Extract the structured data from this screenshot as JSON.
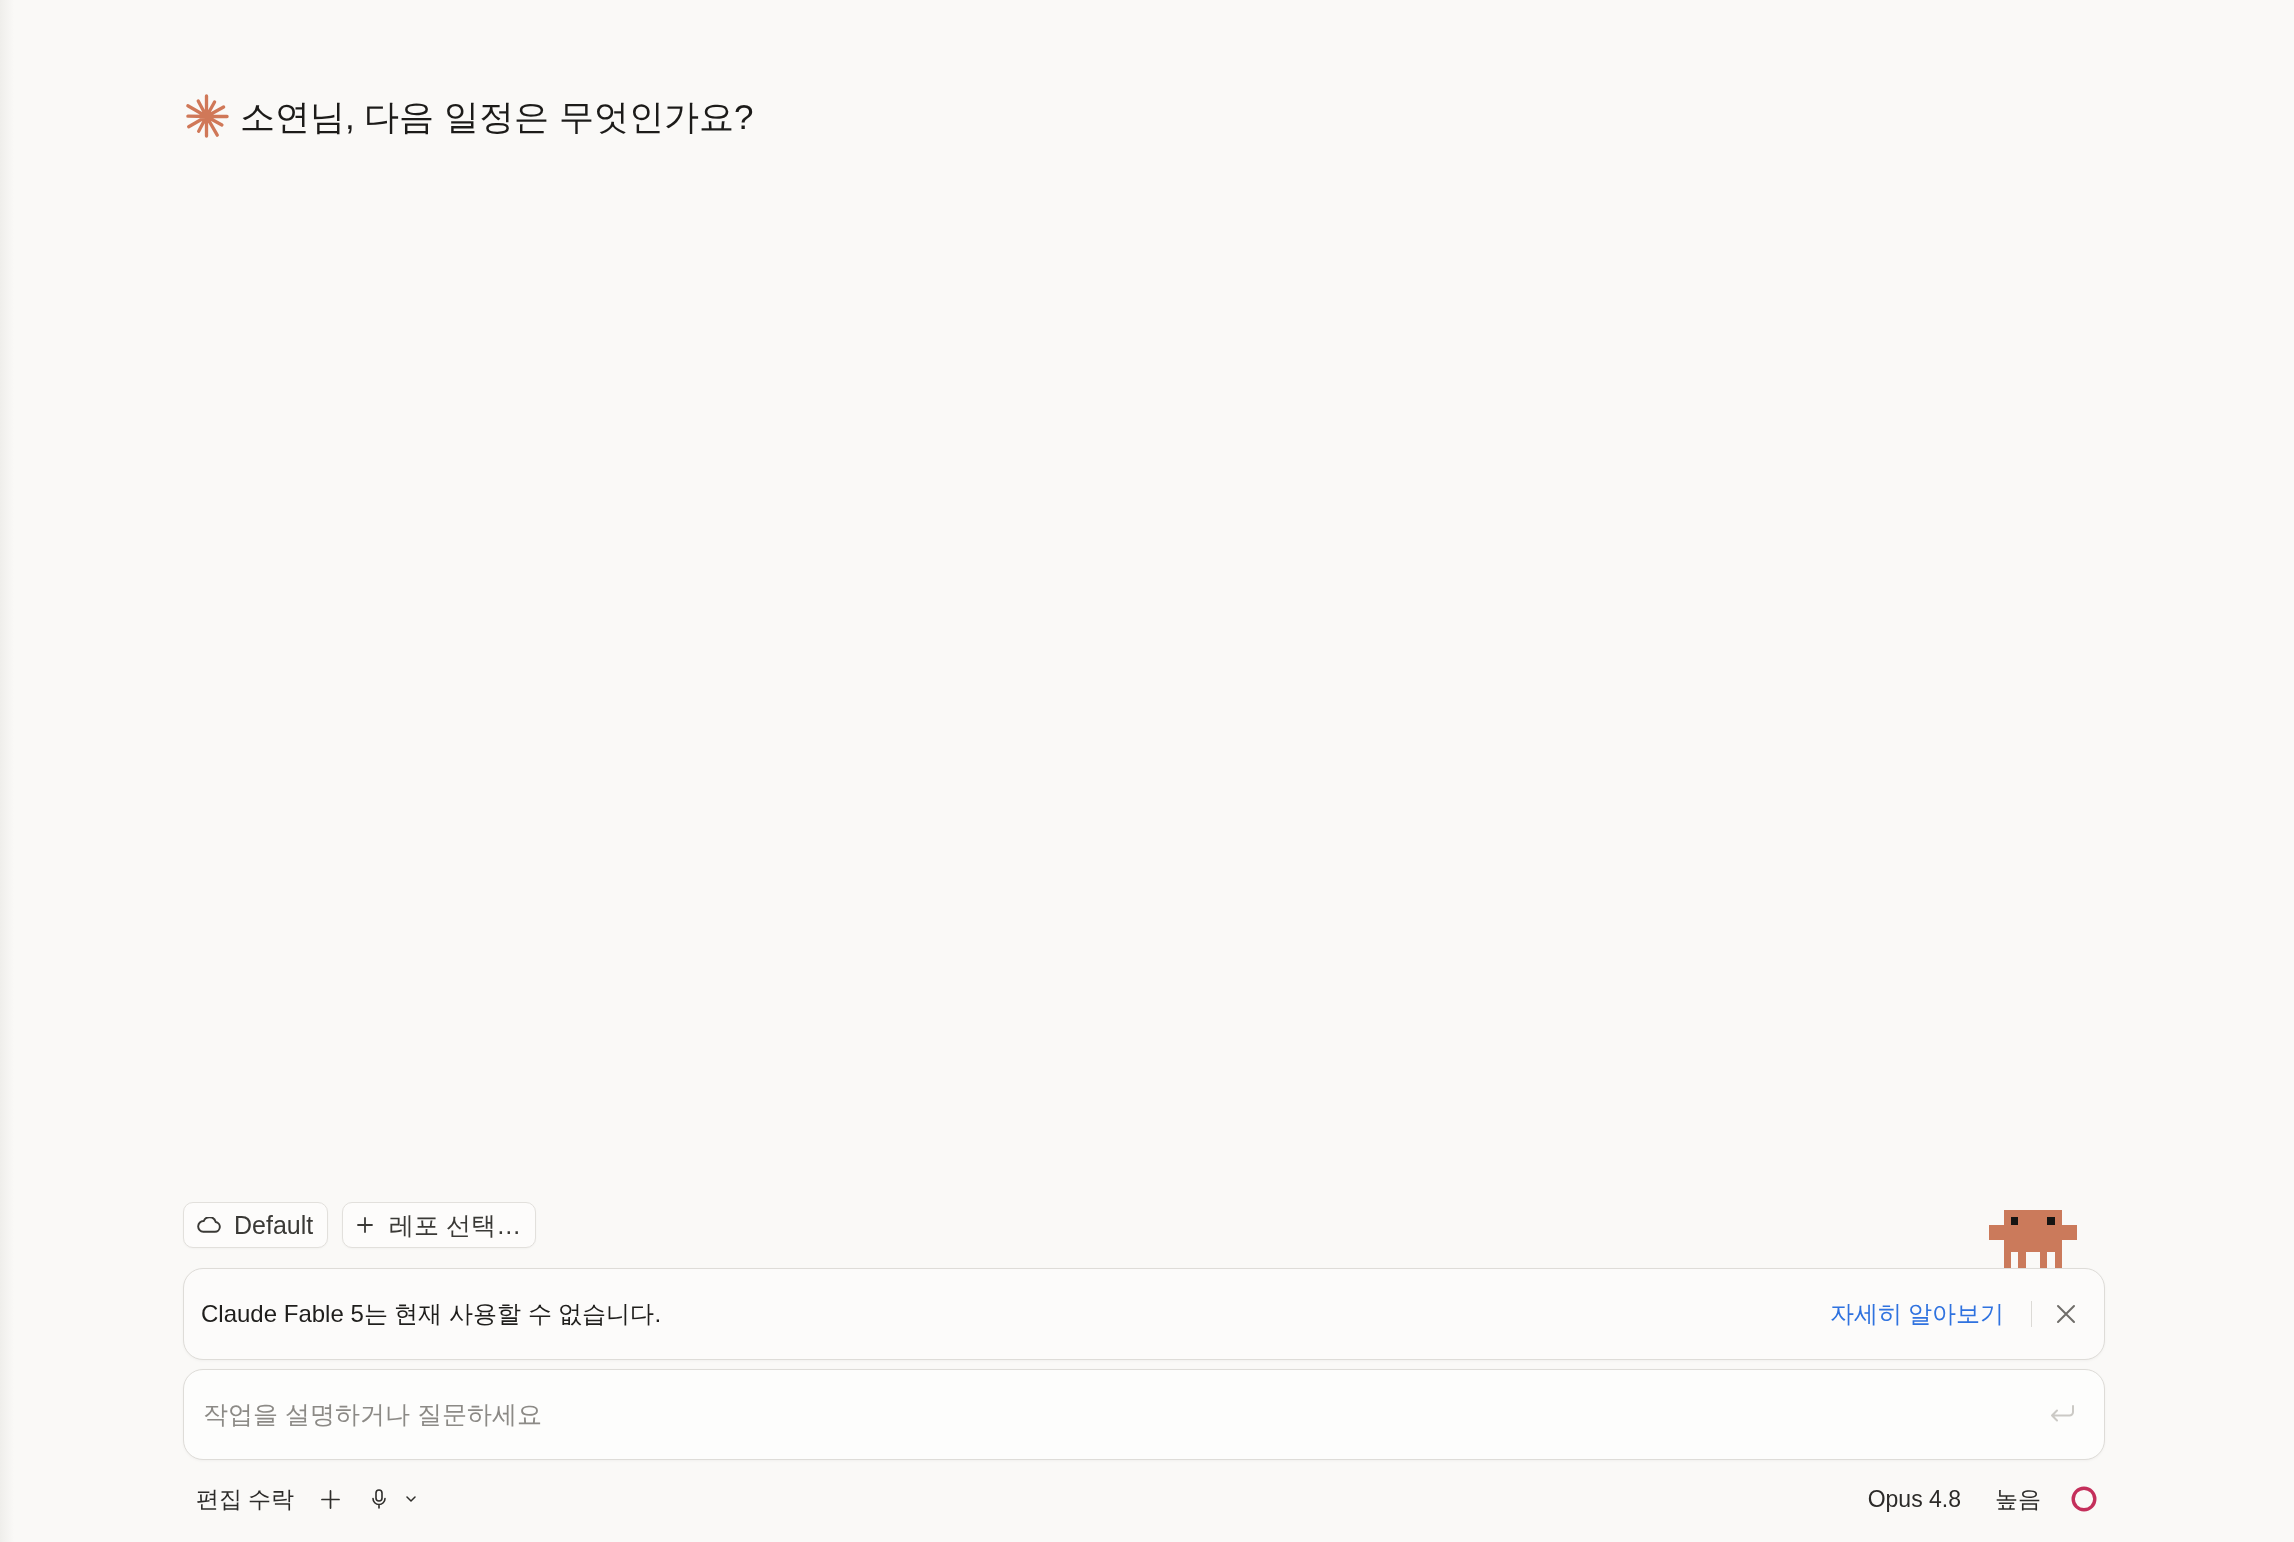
{
  "greeting": {
    "text": "소연님, 다음 일정은 무엇인가요?"
  },
  "chips": [
    {
      "kind": "environment",
      "label": "Default"
    },
    {
      "kind": "repo",
      "label": "레포 선택…"
    }
  ],
  "notice": {
    "message": "Claude Fable 5는 현재 사용할 수 없습니다.",
    "link": "자세히 알아보기"
  },
  "prompt": {
    "placeholder": "작업을 설명하거나 질문하세요"
  },
  "toolbar": {
    "permission_mode": "편집 수락",
    "model": "Opus 4.8",
    "effort": "높음"
  }
}
